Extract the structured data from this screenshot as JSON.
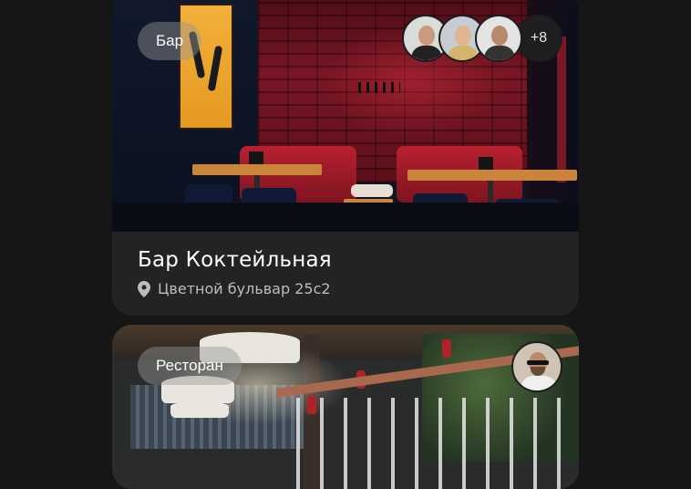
{
  "cards": [
    {
      "category": "Бар",
      "name": "Бар Коктейльная",
      "address": "Цветной бульвар 25с2",
      "avatars": [
        "avatar-1",
        "avatar-2",
        "avatar-3"
      ],
      "more_count": "+8"
    },
    {
      "category": "Ресторан",
      "avatars": [
        "avatar-1"
      ]
    }
  ],
  "icons": {
    "location": "map-pin-icon"
  },
  "colors": {
    "background": "#161617",
    "card": "#232325",
    "tag": "#969696",
    "secondary_text": "#bdbdc0"
  }
}
